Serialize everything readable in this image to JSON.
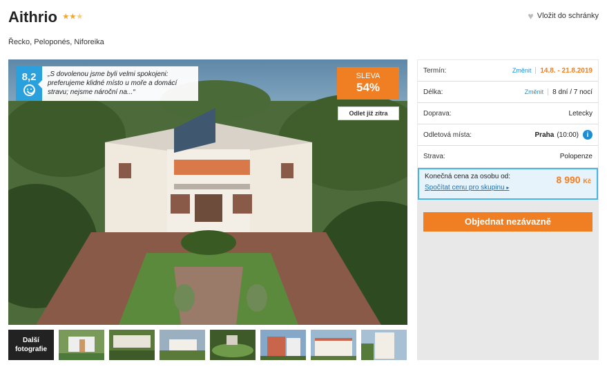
{
  "hotel": {
    "name": "Aithrio",
    "stars": "★★★",
    "location": "Řecko, Peloponés, Niforeika",
    "wishlist_label": "Vložit do schránky"
  },
  "photo": {
    "rating_score": "8,2",
    "rating_quote": "„S dovolenou jsme byli velmi spokojeni: preferujeme klidné místo u moře a domácí stravu; nejsme nároční na...“",
    "discount_label": "SLEVA",
    "discount_value": "54%",
    "departure_badge": "Odlet již zítra"
  },
  "gallery": {
    "more_label": "Další fotografie"
  },
  "booking": {
    "term_label": "Termín:",
    "term_change": "Změnit",
    "term_value": "14.8. - 21.8.2019",
    "length_label": "Délka:",
    "length_change": "Změnit",
    "length_value": "8 dní / 7 nocí",
    "transport_label": "Doprava:",
    "transport_value": "Letecky",
    "departure_label": "Odletová místa:",
    "departure_value": "Praha",
    "departure_time": "(10:00)",
    "board_label": "Strava:",
    "board_value": "Polopenze",
    "price_label": "Konečná cena za osobu od:",
    "price_value": "8 990",
    "price_currency": "Kč",
    "group_price_link": "Spočítat cenu pro skupinu",
    "order_button": "Objednat nezávazně"
  },
  "colors": {
    "accent": "#f07e22",
    "link": "#1a8fd6",
    "rating_bg": "#2aa0dc"
  }
}
